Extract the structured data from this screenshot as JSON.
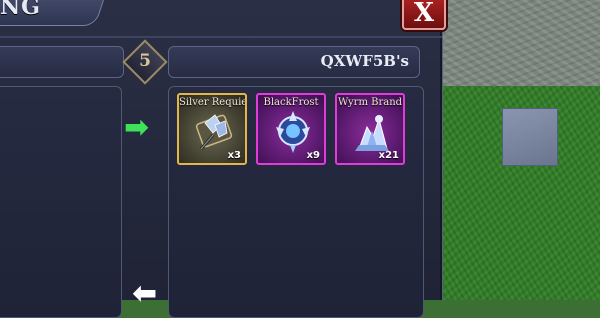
{
  "window": {
    "title": "NG"
  },
  "trade": {
    "item_count": "5",
    "owner_label": "QXWF5B's",
    "items": [
      {
        "name": "Silver Requiem",
        "qty": "x3",
        "rarity_color": "#e2b64a",
        "icon": "silver-requiem-icon"
      },
      {
        "name": "BlackFrost",
        "qty": "x9",
        "rarity_color": "#e13bd9",
        "icon": "blackfrost-icon"
      },
      {
        "name": "Wyrm Brand",
        "qty": "x21",
        "rarity_color": "#e13bd9",
        "icon": "wyrm-brand-icon"
      }
    ]
  },
  "controls": {
    "close_label": "X",
    "arrow_right_glyph": "➡",
    "arrow_left_glyph": "⬅"
  }
}
